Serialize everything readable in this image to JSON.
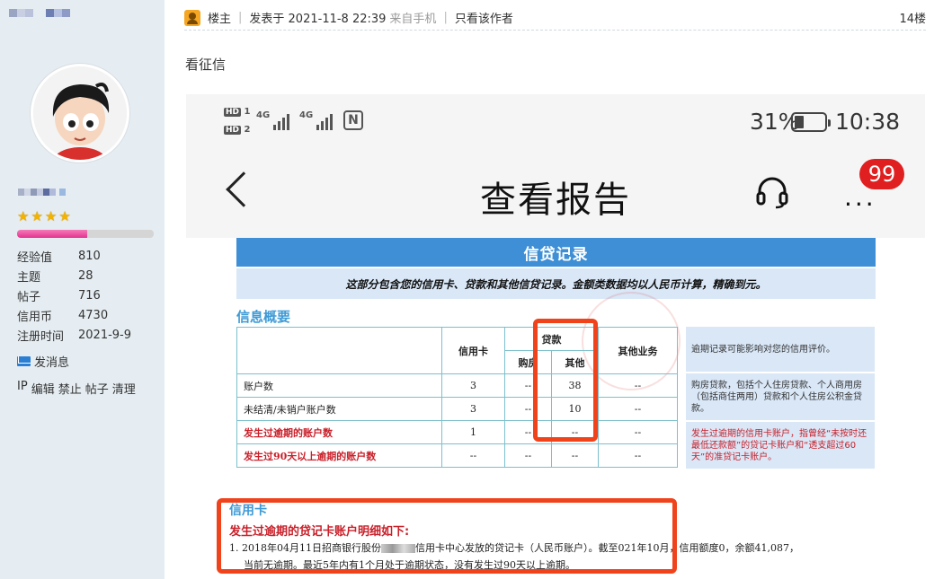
{
  "post": {
    "owner_label": "楼主",
    "posted_at": "发表于 2021-11-8 22:39",
    "source": "来自手机",
    "only_author": "只看该作者",
    "floor": "14楼",
    "text": "看征信"
  },
  "sidebar": {
    "stats": [
      {
        "key": "经验值",
        "value": "810"
      },
      {
        "key": "主题",
        "value": "28"
      },
      {
        "key": "帖子",
        "value": "716"
      },
      {
        "key": "信用币",
        "value": "4730"
      },
      {
        "key": "注册时间",
        "value": "2021-9-9"
      }
    ],
    "stars": [
      "★",
      "★",
      "★",
      "★"
    ],
    "send_message": "发消息",
    "admin_links": [
      "IP",
      "编辑",
      "禁止",
      "帖子",
      "清理"
    ]
  },
  "phone": {
    "hd1": "HD",
    "hd1_num": "1",
    "hd2": "HD",
    "hd2_num": "2",
    "sig1_label": "4G",
    "sig2_label": "4G",
    "nfc": "N",
    "battery": "31%",
    "time": "10:38",
    "title": "查看报告",
    "more": "···",
    "badge": "99"
  },
  "report": {
    "header": "信贷记录",
    "subtitle": "这部分包含您的信用卡、贷款和其他信贷记录。金额类数据均以人民币计算，精确到元。",
    "section": "信息概要",
    "cols": {
      "credit_card": "信用卡",
      "loan": "贷款",
      "house": "购房",
      "other": "其他",
      "other_biz": "其他业务"
    },
    "rows": [
      {
        "label": "账户数",
        "red": false,
        "cc": "3",
        "house": "--",
        "other": "38",
        "biz": "--"
      },
      {
        "label": "未结清/未销户账户数",
        "red": false,
        "cc": "3",
        "house": "--",
        "other": "10",
        "biz": "--"
      },
      {
        "label": "发生过逾期的账户数",
        "red": true,
        "cc": "1",
        "house": "--",
        "other": "--",
        "biz": "--"
      },
      {
        "label": "发生过90天以上逾期的账户数",
        "red": true,
        "cc": "--",
        "house": "--",
        "other": "--",
        "biz": "--"
      }
    ],
    "notes": [
      {
        "text": "逾期记录可能影响对您的信用评价。",
        "red": false
      },
      {
        "text": "购房贷款，包括个人住房贷款、个人商用房（包括商住两用）贷款和个人住房公积金贷款。",
        "red": false
      },
      {
        "text": "发生过逾期的信用卡账户，指曾经“未按时还最低还款额”的贷记卡账户和“透支超过60天”的准贷记卡账户。",
        "red": true
      }
    ],
    "cc_title": "信用卡",
    "cc_overdue": "发生过逾期的贷记卡账户明细如下:",
    "cc_line1a": "1. 2018年04月11日招商银行股份",
    "cc_line1b": "信用卡中心发放的贷记卡（人民币账户）。截至",
    "cc_line1c": "021年10月，信用额度0，余额41,087，",
    "cc_line2": "当前无逾期。最近5年内有1个月处于逾期状态，没有发生过90天以上逾期。"
  },
  "colors": {
    "sidebar_bg": "#e5edf2",
    "report_blue": "#3e8fd6",
    "highlight": "#f0431c",
    "red_text": "#c8202a"
  }
}
